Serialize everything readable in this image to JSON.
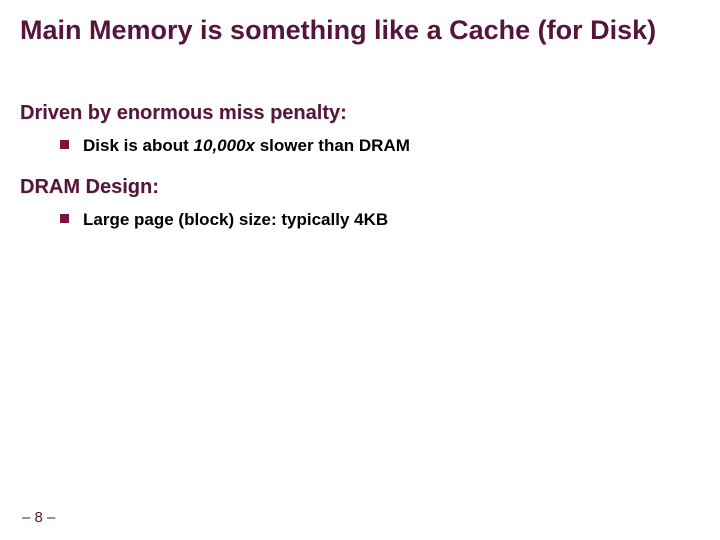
{
  "title": "Main Memory is something like a Cache (for Disk)",
  "sections": [
    {
      "heading": "Driven by enormous miss penalty:",
      "items": [
        {
          "pre": "Disk is about ",
          "emph": "10,000x",
          "post": " slower than DRAM"
        }
      ]
    },
    {
      "heading": "DRAM Design:",
      "items": [
        {
          "pre": "Large page (block) size: typically 4KB",
          "emph": "",
          "post": ""
        }
      ]
    }
  ],
  "page_number": "– 8 –"
}
